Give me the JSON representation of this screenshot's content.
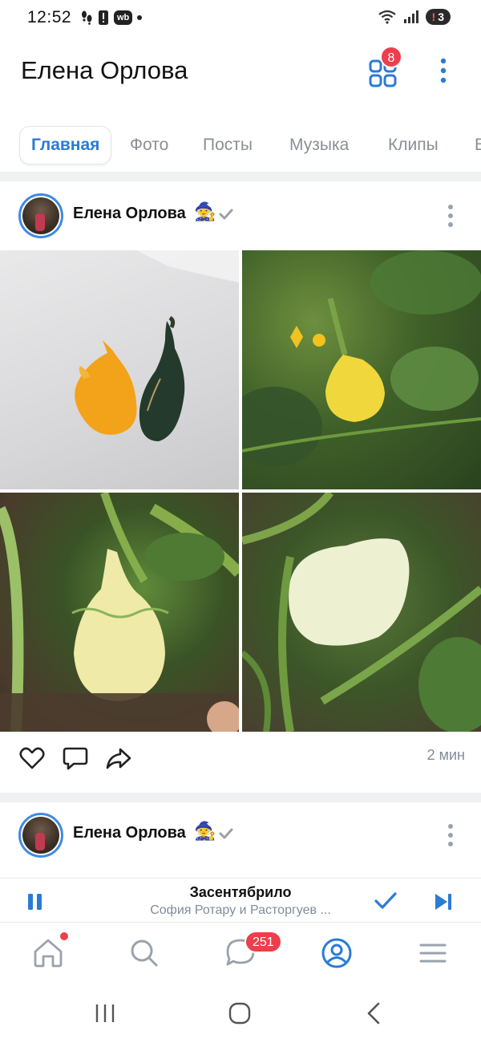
{
  "status_bar": {
    "time": "12:52",
    "badge_wb": "wb",
    "battery": "3",
    "battery_warn": "!"
  },
  "header": {
    "title": "Елена Орлова",
    "apps_badge": "8",
    "icons": [
      "apps-grid-icon",
      "more-vertical-icon"
    ]
  },
  "tabs": [
    {
      "label": "Главная",
      "active": true
    },
    {
      "label": "Фото",
      "active": false
    },
    {
      "label": "Посты",
      "active": false
    },
    {
      "label": "Музыка",
      "active": false
    },
    {
      "label": "Клипы",
      "active": false
    },
    {
      "label": "В",
      "active": false
    }
  ],
  "post": {
    "author": "Елена Орлова",
    "emoji": "🧙",
    "time": "2 мин",
    "photos": [
      {
        "description_icon": "gourds-photo"
      },
      {
        "description_icon": "yellow-gourd-photo"
      },
      {
        "description_icon": "warty-gourd-photo"
      },
      {
        "description_icon": "white-gourd-photo"
      }
    ],
    "actions": [
      "like-icon",
      "comment-icon",
      "share-icon"
    ]
  },
  "post2": {
    "author": "Елена Орлова",
    "emoji": "🧙"
  },
  "player": {
    "title": "Засентябрило",
    "artist": "София Ротару и Расторгуев ..."
  },
  "tabbar": {
    "items": [
      "home-icon",
      "search-icon",
      "messages-icon",
      "profile-icon",
      "menu-icon"
    ],
    "messages_badge": "251"
  },
  "colors": {
    "accent": "#2a7bd5",
    "badge": "#ed3f4b",
    "secondary_text": "#818c99"
  }
}
